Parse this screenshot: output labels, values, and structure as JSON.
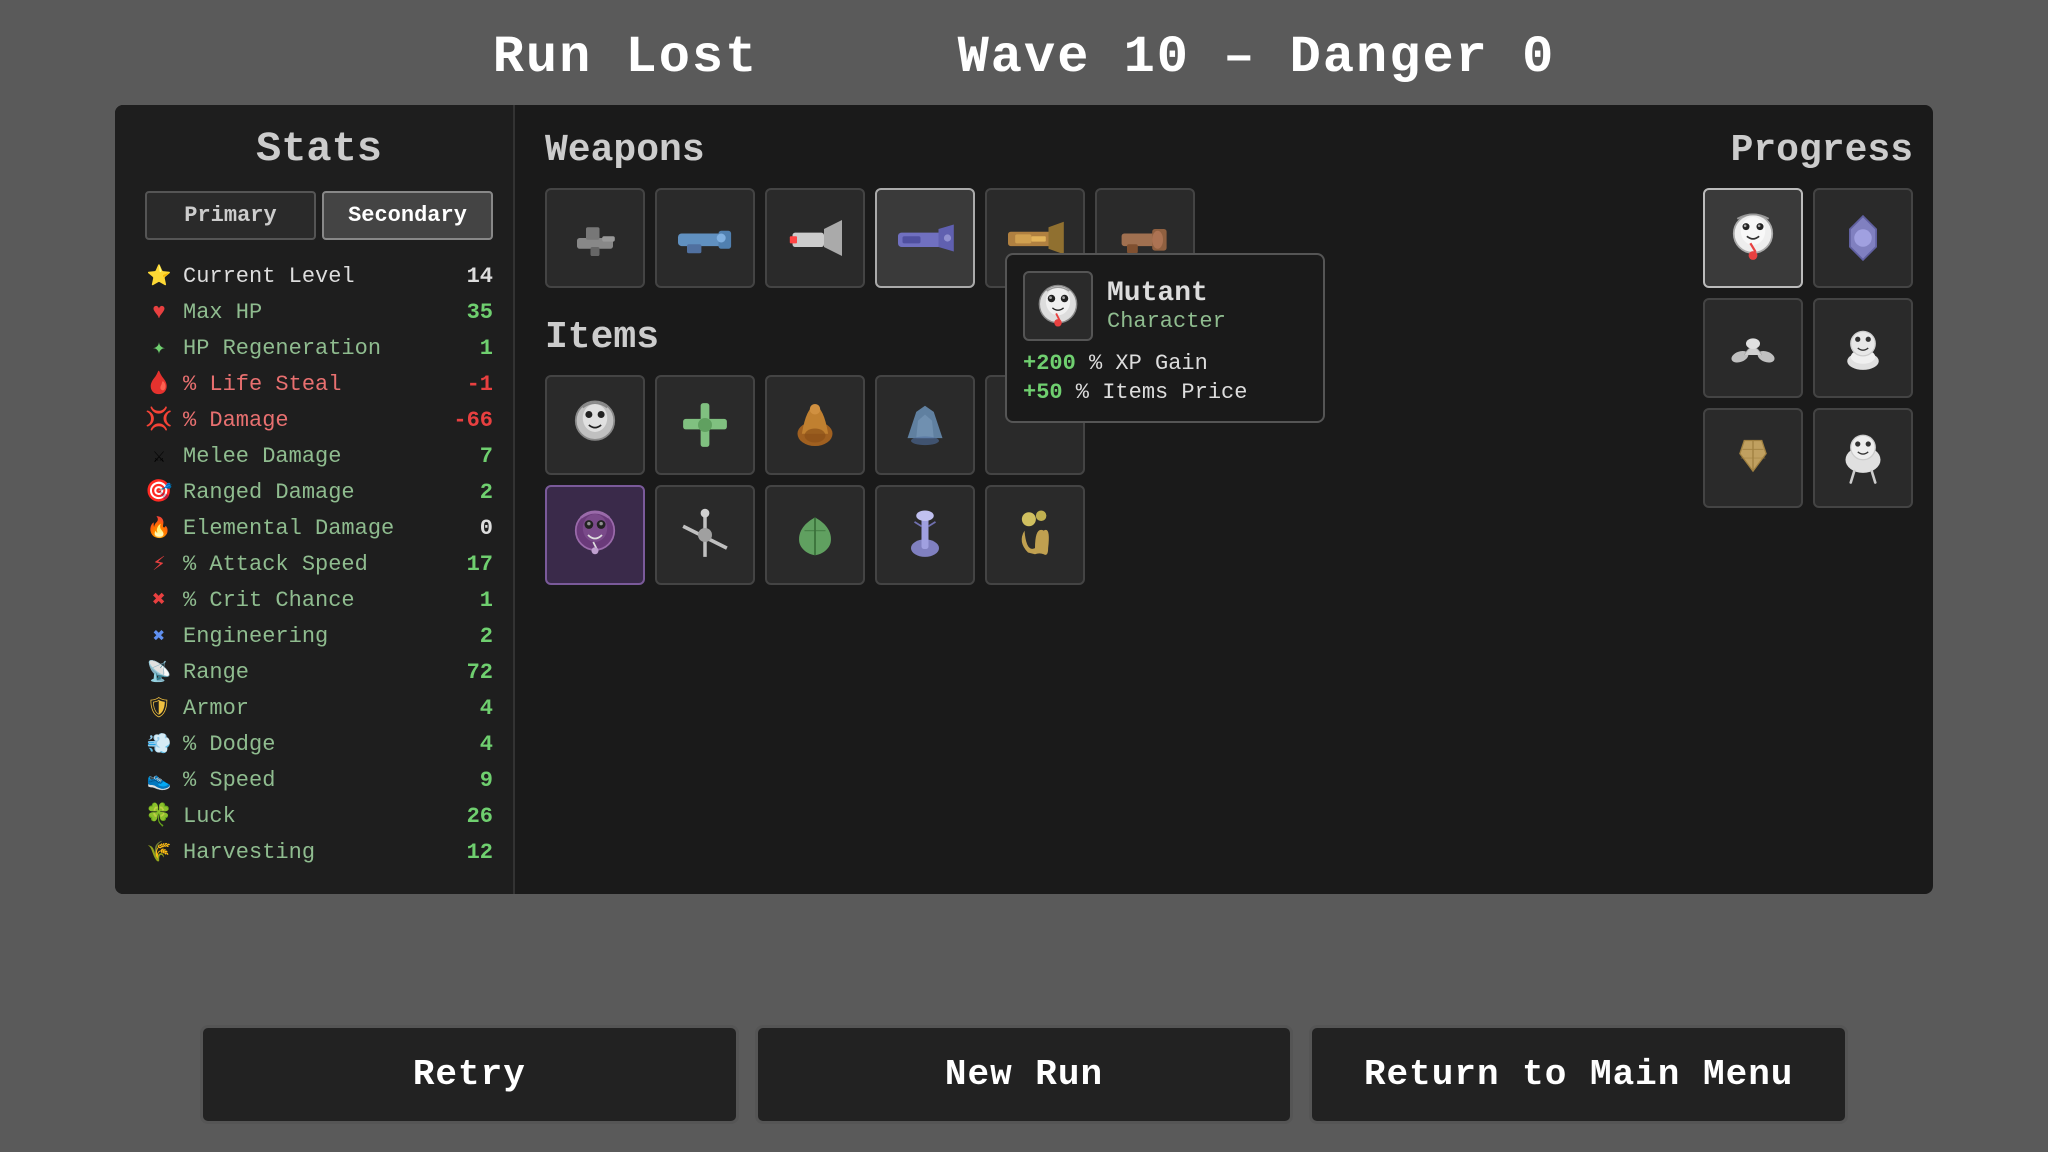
{
  "header": {
    "run_lost": "Run Lost",
    "wave_info": "Wave 10 – Danger 0"
  },
  "stats": {
    "title": "Stats",
    "tabs": [
      {
        "label": "Primary",
        "active": false
      },
      {
        "label": "Secondary",
        "active": true
      }
    ],
    "rows": [
      {
        "icon": "⭐",
        "name": "Current Level",
        "value": "14",
        "name_color": "white",
        "val_color": "white"
      },
      {
        "icon": "💚",
        "name": "Max HP",
        "value": "35",
        "name_color": "green",
        "val_color": "green"
      },
      {
        "icon": "✨",
        "name": "HP Regeneration",
        "value": "1",
        "name_color": "green",
        "val_color": "green"
      },
      {
        "icon": "🩸",
        "name": "% Life Steal",
        "value": "-1",
        "name_color": "red",
        "val_color": "red"
      },
      {
        "icon": "💥",
        "name": "% Damage",
        "value": "-66",
        "name_color": "red",
        "val_color": "red"
      },
      {
        "icon": "⚔️",
        "name": "Melee Damage",
        "value": "7",
        "name_color": "green",
        "val_color": "green"
      },
      {
        "icon": "🎯",
        "name": "Ranged Damage",
        "value": "2",
        "name_color": "green",
        "val_color": "green"
      },
      {
        "icon": "🔥",
        "name": "Elemental Damage",
        "value": "0",
        "name_color": "green",
        "val_color": "white"
      },
      {
        "icon": "⚡",
        "name": "% Attack Speed",
        "value": "17",
        "name_color": "green",
        "val_color": "green"
      },
      {
        "icon": "❌",
        "name": "% Crit Chance",
        "value": "1",
        "name_color": "green",
        "val_color": "green"
      },
      {
        "icon": "🔧",
        "name": "Engineering",
        "value": "2",
        "name_color": "green",
        "val_color": "green"
      },
      {
        "icon": "📡",
        "name": "Range",
        "value": "72",
        "name_color": "green",
        "val_color": "green"
      },
      {
        "icon": "🛡️",
        "name": "Armor",
        "value": "4",
        "name_color": "green",
        "val_color": "green"
      },
      {
        "icon": "💨",
        "name": "% Dodge",
        "value": "4",
        "name_color": "green",
        "val_color": "green"
      },
      {
        "icon": "👟",
        "name": "% Speed",
        "value": "9",
        "name_color": "green",
        "val_color": "green"
      },
      {
        "icon": "🍀",
        "name": "Luck",
        "value": "26",
        "name_color": "green",
        "val_color": "green"
      },
      {
        "icon": "🌾",
        "name": "Harvesting",
        "value": "12",
        "name_color": "green",
        "val_color": "green"
      }
    ]
  },
  "weapons": {
    "title": "Weapons",
    "slots": [
      {
        "id": 1,
        "has_item": true,
        "highlighted": false
      },
      {
        "id": 2,
        "has_item": true,
        "highlighted": false
      },
      {
        "id": 3,
        "has_item": true,
        "highlighted": false
      },
      {
        "id": 4,
        "has_item": true,
        "highlighted": true
      },
      {
        "id": 5,
        "has_item": true,
        "highlighted": false
      },
      {
        "id": 6,
        "has_item": true,
        "highlighted": false
      }
    ]
  },
  "items": {
    "title": "Items",
    "slots": [
      {
        "id": 1,
        "has_item": true,
        "special": false,
        "icon": "🎭"
      },
      {
        "id": 2,
        "has_item": true,
        "special": false,
        "icon": "➕"
      },
      {
        "id": 3,
        "has_item": true,
        "special": false,
        "icon": "🧪"
      },
      {
        "id": 4,
        "has_item": true,
        "special": false,
        "icon": "🛡"
      },
      {
        "id": 5,
        "has_item": false,
        "special": false,
        "icon": ""
      },
      {
        "id": 6,
        "has_item": false,
        "special": false,
        "icon": ""
      },
      {
        "id": 7,
        "has_item": false,
        "special": false,
        "icon": ""
      },
      {
        "id": 8,
        "has_item": false,
        "special": false,
        "icon": ""
      },
      {
        "id": 9,
        "has_item": true,
        "special": true,
        "icon": "🧟"
      },
      {
        "id": 10,
        "has_item": true,
        "special": false,
        "icon": "💉"
      },
      {
        "id": 11,
        "has_item": true,
        "special": false,
        "icon": "🌿"
      },
      {
        "id": 12,
        "has_item": true,
        "special": false,
        "icon": "🚀"
      },
      {
        "id": 13,
        "has_item": true,
        "special": false,
        "icon": "🏆"
      }
    ]
  },
  "progress": {
    "title": "Progress",
    "slots": [
      {
        "id": 1,
        "has_item": true,
        "highlighted": true,
        "icon": "mutant"
      }
    ]
  },
  "progress_extra_slots": [
    {
      "id": 2,
      "has_item": true,
      "icon": "🔱"
    },
    {
      "id": 3,
      "has_item": true,
      "icon": "🦴"
    },
    {
      "id": 4,
      "has_item": true,
      "icon": "🦷"
    },
    {
      "id": 5,
      "has_item": true,
      "icon": "🔧"
    },
    {
      "id": 6,
      "has_item": true,
      "icon": "💀"
    }
  ],
  "tooltip": {
    "name": "Mutant",
    "type": "Character",
    "stat1_prefix": "+200",
    "stat1_text": " % XP Gain",
    "stat2_prefix": "+50",
    "stat2_text": " % Items Price"
  },
  "buttons": {
    "retry": "Retry",
    "new_run": "New Run",
    "return": "Return to Main Menu"
  }
}
